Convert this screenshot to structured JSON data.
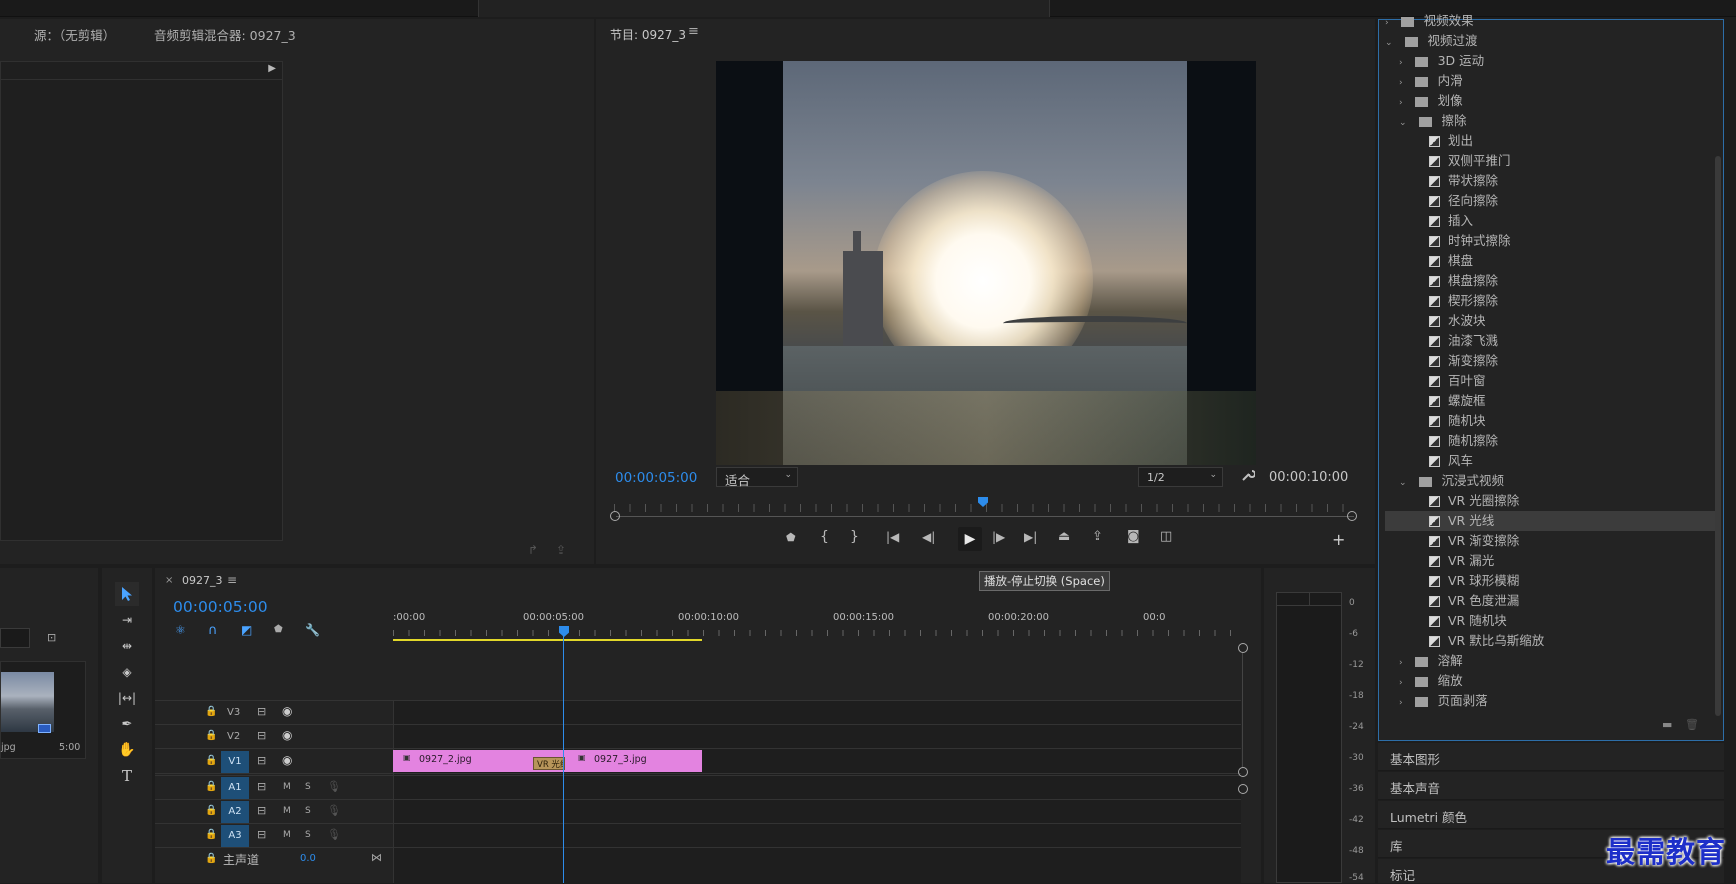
{
  "source_panel": {
    "source_tab": "源：（无剪辑）",
    "mixer_tab": "音频剪辑混合器: 0927_3"
  },
  "project_panel": {
    "thumb_name": "jpg",
    "thumb_duration": "5:00"
  },
  "program_monitor": {
    "title": "节目: 0927_3",
    "timecode": "00:00:05:00",
    "fit_select": "适合",
    "resolution_select": "1/2",
    "duration": "00:00:10:00",
    "tooltip": "播放-停止切换 (Space)"
  },
  "timeline": {
    "sequence_name": "0927_3",
    "timecode": "00:00:05:00",
    "ruler": [
      ":00:00",
      "00:00:05:00",
      "00:00:10:00",
      "00:00:15:00",
      "00:00:20:00",
      "00:0"
    ],
    "tracks": {
      "v3": "V3",
      "v2": "V2",
      "v1": "V1",
      "a1": "A1",
      "a2": "A2",
      "a3": "A3",
      "m": "M",
      "s": "S"
    },
    "master_label": "主声道",
    "master_value": "0.0",
    "clips": {
      "clip1": "0927_2.jpg",
      "clip2": "0927_3.jpg",
      "transition": "VR 光线"
    }
  },
  "meter": {
    "scale": [
      "0",
      "-6",
      "-12",
      "-18",
      "-24",
      "-30",
      "-36",
      "-42",
      "-48",
      "-54"
    ]
  },
  "effects_tree": {
    "top_partial": "视频效果",
    "video_transitions": "视频过渡",
    "cat_3d": "3D 运动",
    "cat_slide": "内滑",
    "cat_iris": "划像",
    "cat_wipe": "擦除",
    "wipe_items": [
      "划出",
      "双侧平推门",
      "带状擦除",
      "径向擦除",
      "插入",
      "时钟式擦除",
      "棋盘",
      "棋盘擦除",
      "楔形擦除",
      "水波块",
      "油漆飞溅",
      "渐变擦除",
      "百叶窗",
      "螺旋框",
      "随机块",
      "随机擦除",
      "风车"
    ],
    "cat_immersive": "沉浸式视频",
    "immersive_items": [
      "VR 光圈擦除",
      "VR 光线",
      "VR 渐变擦除",
      "VR 漏光",
      "VR 球形模糊",
      "VR 色度泄漏",
      "VR 随机块",
      "VR 默比乌斯缩放"
    ],
    "cat_dissolve": "溶解",
    "cat_zoom": "缩放",
    "cat_page": "页面剥落"
  },
  "side_panels": {
    "essential_graphics": "基本图形",
    "essential_sound": "基本声音",
    "lumetri": "Lumetri 颜色",
    "libraries": "库",
    "markers": "标记"
  },
  "watermark": "最需教育",
  "colors": {
    "accent_blue": "#2d8ceb",
    "clip_pink": "#e383e0",
    "work_area_yellow": "#e2d82a",
    "selected_row": "#3c3c3c"
  }
}
